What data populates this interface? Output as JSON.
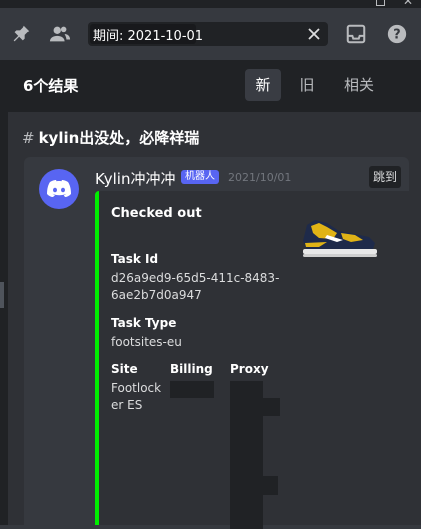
{
  "window": {
    "maximize_icon": "maximize-icon",
    "close_label": "✕"
  },
  "toolbar": {
    "pin_icon": "pin-icon",
    "members_icon": "members-icon",
    "search": {
      "value": "期间: 2021-10-01",
      "clear_icon": "close-icon"
    },
    "inbox_icon": "inbox-icon",
    "help_icon": "help-icon"
  },
  "results": {
    "count_label": "6个结果",
    "tabs": [
      {
        "label": "新",
        "active": true
      },
      {
        "label": "旧",
        "active": false
      },
      {
        "label": "相关",
        "active": false
      }
    ]
  },
  "channel": {
    "hash": "#",
    "name": "kylin出没处，必降祥瑞"
  },
  "message": {
    "avatar_icon": "discord-logo-icon",
    "author": "Kylin冲冲冲",
    "badge": "机器人",
    "timestamp": "2021/10/01",
    "jump_label": "跳到",
    "embed": {
      "accent_color": "#00ee00",
      "title": "Checked out",
      "thumbnail": "sneaker-image",
      "fields": {
        "task_id_name": "Task Id",
        "task_id_value_1": "d26a9ed9-65d5-411c-8483-",
        "task_id_value_2": "6ae2b7d0a947",
        "task_type_name": "Task Type",
        "task_type_value": "footsites-eu",
        "site_name": "Site",
        "site_value_1": "Footlock",
        "site_value_2": "er ES",
        "billing_name": "Billing",
        "proxy_name": "Proxy"
      }
    }
  },
  "colors": {
    "background": "#36393f",
    "panel": "#2f3136",
    "header": "#202225",
    "brand": "#5865f2"
  }
}
